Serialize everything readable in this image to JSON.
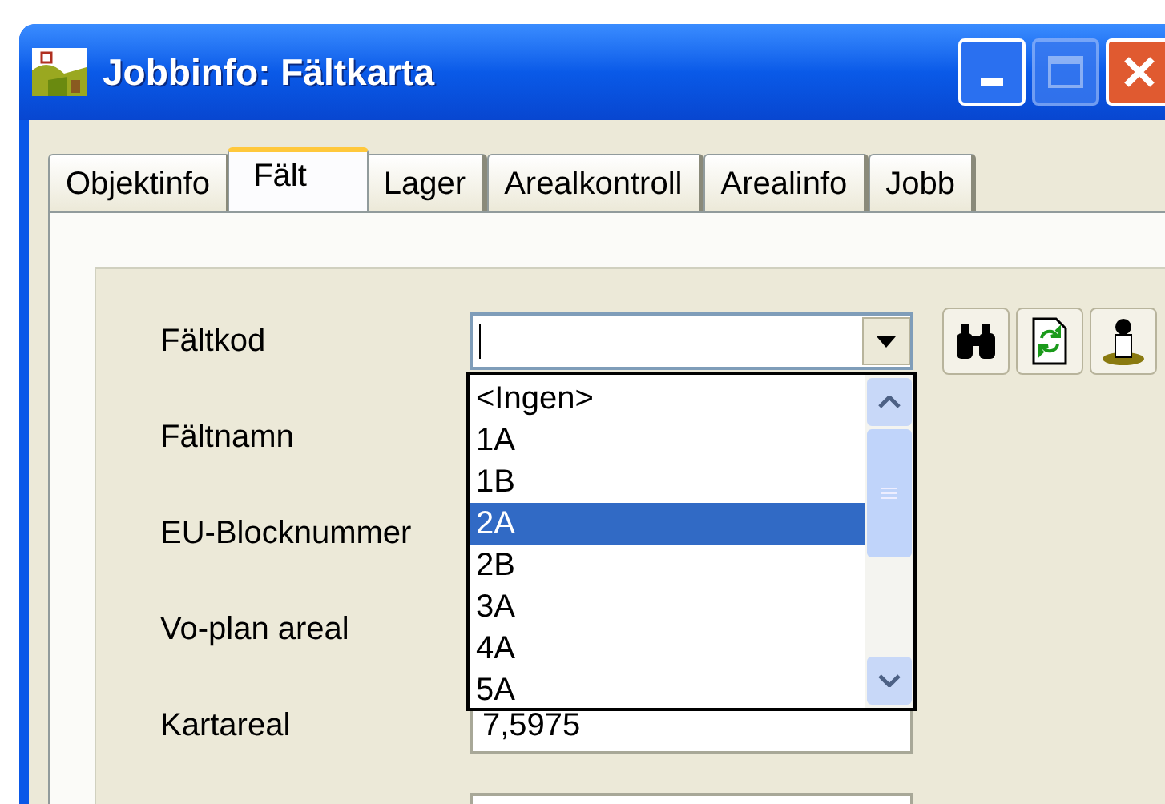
{
  "window": {
    "title": "Jobbinfo: Fältkarta"
  },
  "tabs": [
    {
      "label": "Objektinfo",
      "selected": false
    },
    {
      "label": "Fält",
      "selected": true
    },
    {
      "label": "Lager",
      "selected": false
    },
    {
      "label": "Arealkontroll",
      "selected": false
    },
    {
      "label": "Arealinfo",
      "selected": false
    },
    {
      "label": "Jobb",
      "selected": false
    }
  ],
  "fields": [
    {
      "label": "Fältkod",
      "kind": "combo"
    },
    {
      "label": "Fältnamn",
      "kind": "hidden"
    },
    {
      "label": "EU-Blocknummer",
      "kind": "hidden"
    },
    {
      "label": "Vo-plan areal",
      "kind": "hidden"
    },
    {
      "label": "Kartareal",
      "kind": "text",
      "value": "7,5975"
    },
    {
      "kind": "text"
    }
  ],
  "dropdown": {
    "items": [
      {
        "label": "<Ingen>",
        "selected": false
      },
      {
        "label": "1A",
        "selected": false
      },
      {
        "label": "1B",
        "selected": false
      },
      {
        "label": "2A",
        "selected": true
      },
      {
        "label": "2B",
        "selected": false
      },
      {
        "label": "3A",
        "selected": false
      },
      {
        "label": "4A",
        "selected": false
      },
      {
        "label": "5A",
        "selected": false
      }
    ]
  }
}
